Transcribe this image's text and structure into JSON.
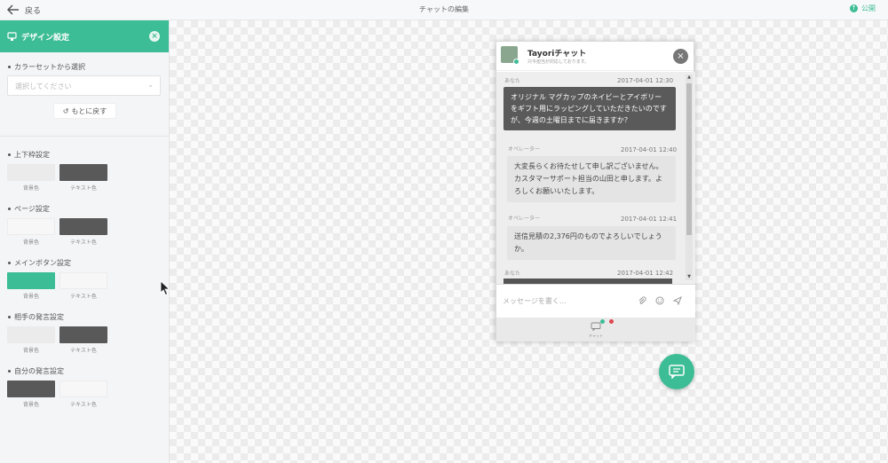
{
  "topbar": {
    "back_label": "戻る",
    "title": "チャットの編集",
    "publish_label": "公開"
  },
  "sidebar": {
    "header_title": "デザイン設定",
    "colorset_label": "カラーセットから選択",
    "colorset_placeholder": "選択してください",
    "reset_label": "もとに戻す",
    "sections": [
      {
        "label": "上下枠設定",
        "bg_caption": "背景色",
        "text_caption": "テキスト色",
        "bg_color": "#ebebeb",
        "text_color": "#595959"
      },
      {
        "label": "ページ設定",
        "bg_caption": "背景色",
        "text_caption": "テキスト色",
        "bg_color": "#f7f7f7",
        "text_color": "#595959"
      },
      {
        "label": "メインボタン設定",
        "bg_caption": "背景色",
        "text_caption": "テキスト色",
        "bg_color": "#3dbd95",
        "text_color": "#f7f7f7"
      },
      {
        "label": "相手の発言設定",
        "bg_caption": "背景色",
        "text_caption": "テキスト色",
        "bg_color": "#ebebeb",
        "text_color": "#595959"
      },
      {
        "label": "自分の発言設定",
        "bg_caption": "背景色",
        "text_caption": "テキスト色",
        "bg_color": "#595959",
        "text_color": "#f7f7f7"
      }
    ]
  },
  "widget": {
    "name": "Tayoriチャット",
    "status": "只今担当が対応しております。",
    "messages": [
      {
        "sender": "あなた",
        "time": "2017-04-01 12:30",
        "text": "オリジナル マグカップのネイビーとアイボリーをギフト用にラッピングしていただきたいのですが、今週の土曜日までに届きますか？"
      },
      {
        "sender": "オペレーター",
        "time": "2017-04-01 12:40",
        "text": "大変長らくお待たせして申し訳ございません。カスタマーサポート担当の山田と申します。よろしくお願いいたします。"
      },
      {
        "sender": "オペレーター",
        "time": "2017-04-01 12:41",
        "text": "送信見積の2,376円のものでよろしいでしょうか。"
      },
      {
        "sender": "あなた",
        "time": "2017-04-01 12:42",
        "text": ""
      }
    ],
    "input_placeholder": "メッセージを書く…",
    "footer_tab": "チャット"
  },
  "colors": {
    "accent": "#3dbd95",
    "dark": "#5a5a5a",
    "red_dot": "#e0454f"
  }
}
